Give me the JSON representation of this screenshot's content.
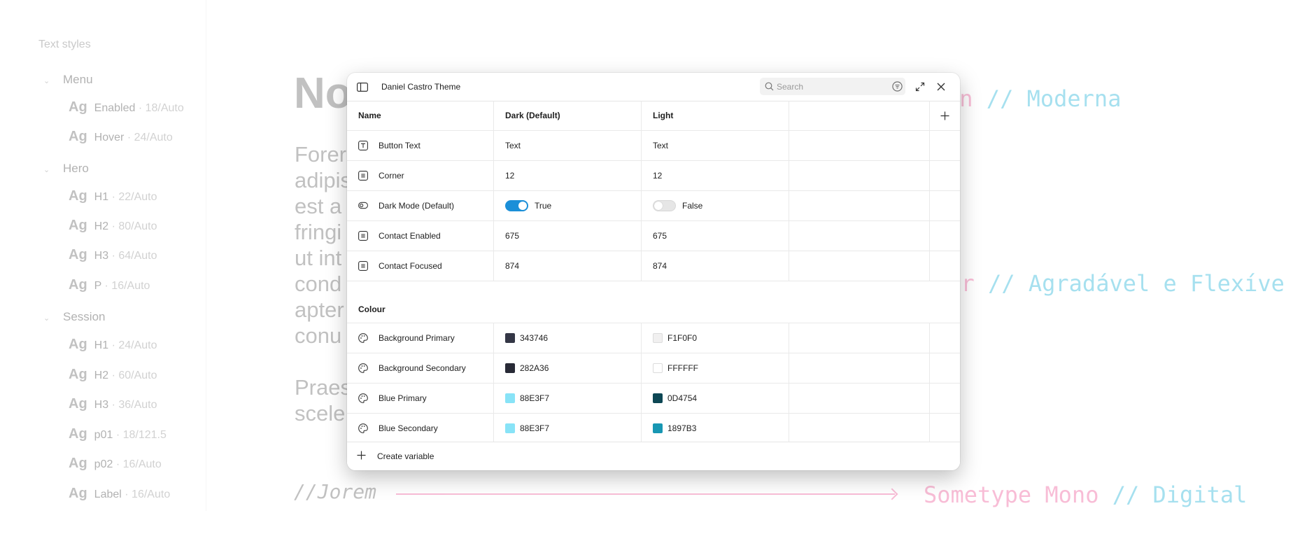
{
  "background": {
    "sidebar": {
      "title": "Text styles",
      "groups": [
        {
          "name": "Menu",
          "styles": [
            {
              "ag": "Ag",
              "name": "Enabled",
              "meta": "· 18/Auto"
            },
            {
              "ag": "Ag",
              "name": "Hover",
              "meta": "· 24/Auto"
            }
          ]
        },
        {
          "name": "Hero",
          "styles": [
            {
              "ag": "Ag",
              "name": "H1",
              "meta": "· 22/Auto"
            },
            {
              "ag": "Ag",
              "name": "H2",
              "meta": "· 80/Auto"
            },
            {
              "ag": "Ag",
              "name": "H3",
              "meta": "· 64/Auto"
            },
            {
              "ag": "Ag",
              "name": "P",
              "meta": "· 16/Auto"
            }
          ]
        },
        {
          "name": "Session",
          "styles": [
            {
              "ag": "Ag",
              "name": "H1",
              "meta": "· 24/Auto"
            },
            {
              "ag": "Ag",
              "name": "H2",
              "meta": "· 60/Auto"
            },
            {
              "ag": "Ag",
              "name": "H3",
              "meta": "· 36/Auto"
            },
            {
              "ag": "Ag",
              "name": "p01",
              "meta": "· 18/121.5"
            },
            {
              "ag": "Ag",
              "name": "p02",
              "meta": "· 16/Auto"
            },
            {
              "ag": "Ag",
              "name": "Label",
              "meta": "· 16/Auto"
            }
          ]
        }
      ]
    },
    "heading_fragment": "No",
    "lorem_lines": [
      "Forer",
      "adipis",
      "est a",
      "fringi",
      "ut int",
      "cond",
      "apter",
      "conu"
    ],
    "lorem2_lines": [
      "Praes",
      "scele"
    ],
    "font_notes": [
      {
        "part1": "in",
        "sep": " // ",
        "part2": "Moderna"
      },
      {
        "part1": "ter",
        "sep": " // ",
        "part2": "Agradável e Flexíve"
      },
      {
        "part1": "Sometype Mono",
        "sep": " // ",
        "part2": "Digital"
      }
    ],
    "jorem": "//Jorem"
  },
  "modal": {
    "title": "Daniel Castro Theme",
    "search_placeholder": "Search",
    "columns": {
      "name": "Name",
      "dark": "Dark (Default)",
      "light": "Light"
    },
    "rows": [
      {
        "icon": "text-icon",
        "name": "Button Text",
        "type": "string",
        "dark": "Text",
        "light": "Text"
      },
      {
        "icon": "number-icon",
        "name": "Corner",
        "type": "number",
        "dark": "12",
        "light": "12"
      },
      {
        "icon": "boolean-icon",
        "name": "Dark Mode (Default)",
        "type": "boolean",
        "dark": "True",
        "light": "False",
        "dark_on": true,
        "light_on": false
      },
      {
        "icon": "number-icon",
        "name": "Contact Enabled",
        "type": "number",
        "dark": "675",
        "light": "675"
      },
      {
        "icon": "number-icon",
        "name": "Contact Focused",
        "type": "number",
        "dark": "874",
        "light": "874"
      }
    ],
    "colour_section": "Colour",
    "colour_rows": [
      {
        "icon": "palette-icon",
        "name": "Background Primary",
        "dark": "343746",
        "dark_color": "#343746",
        "light": "F1F0F0",
        "light_color": "#F1F0F0"
      },
      {
        "icon": "palette-icon",
        "name": "Background Secondary",
        "dark": "282A36",
        "dark_color": "#282A36",
        "light": "FFFFFF",
        "light_color": "#FFFFFF"
      },
      {
        "icon": "palette-icon",
        "name": "Blue Primary",
        "dark": "88E3F7",
        "dark_color": "#88E3F7",
        "light": "0D4754",
        "light_color": "#0D4754"
      },
      {
        "icon": "palette-icon",
        "name": "Blue Secondary",
        "dark": "88E3F7",
        "dark_color": "#88E3F7",
        "light": "1897B3",
        "light_color": "#1897B3"
      }
    ],
    "create_label": "Create variable"
  }
}
